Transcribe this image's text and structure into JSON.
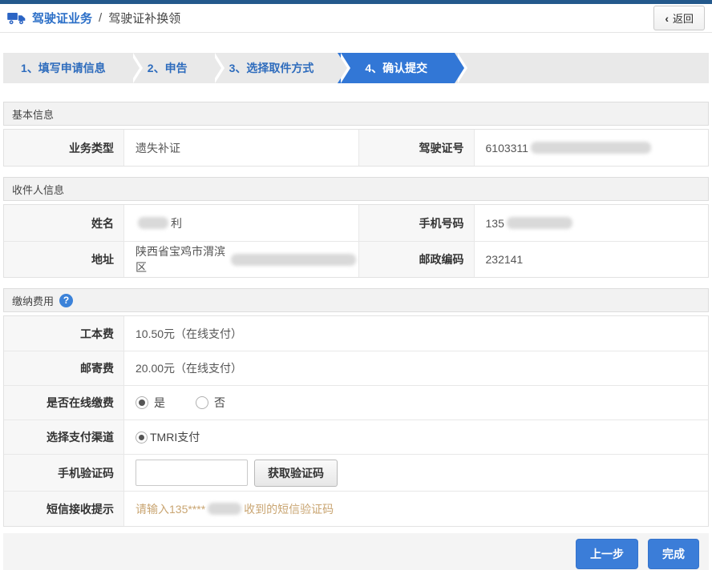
{
  "header": {
    "title": "驾驶证业务",
    "separator": "/",
    "subtitle": "驾驶证补换领",
    "back": {
      "chevron": "‹",
      "label": "返回"
    }
  },
  "steps": [
    {
      "label": "1、填写申请信息",
      "active": false
    },
    {
      "label": "2、申告",
      "active": false
    },
    {
      "label": "3、选择取件方式",
      "active": false
    },
    {
      "label": "4、确认提交",
      "active": true
    }
  ],
  "basic": {
    "title": "基本信息",
    "type_label": "业务类型",
    "type_value": "遗失补证",
    "license_label": "驾驶证号",
    "license_prefix": "6103311"
  },
  "recipient": {
    "title": "收件人信息",
    "name_label": "姓名",
    "name_suffix": "利",
    "phone_label": "手机号码",
    "phone_prefix": "135",
    "address_label": "地址",
    "address_prefix": "陕西省宝鸡市渭滨区",
    "postcode_label": "邮政编码",
    "postcode_value": "232141"
  },
  "payment": {
    "title": "缴纳费用",
    "help_glyph": "?",
    "fee_label": "工本费",
    "fee_value": "10.50元（在线支付）",
    "postage_label": "邮寄费",
    "postage_value": "20.00元（在线支付）",
    "online_label": "是否在线缴费",
    "option_yes": "是",
    "option_no": "否",
    "channel_label": "选择支付渠道",
    "channel_option": "TMRI支付",
    "code_label": "手机验证码",
    "code_button": "获取验证码",
    "sms_label": "短信接收提示",
    "sms_prefix": "请输入135****",
    "sms_suffix": "收到的短信验证码"
  },
  "footer": {
    "prev": "上一步",
    "finish": "完成"
  },
  "colors": {
    "top_bar": "#24598c",
    "accent": "#3b7dd8",
    "step_active": "#3277d6",
    "title_blue": "#2a6ec7",
    "hint_text": "#c9a572"
  }
}
